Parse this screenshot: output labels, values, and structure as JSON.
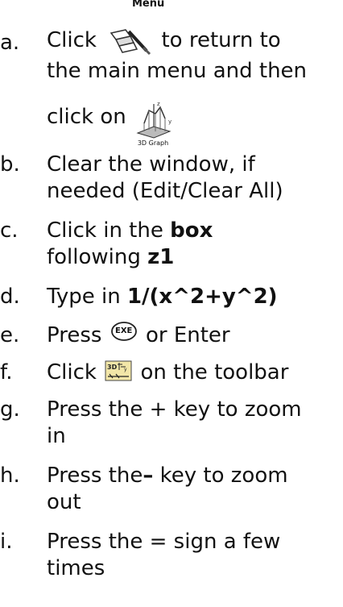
{
  "steps": [
    {
      "letter": "a.",
      "pre": "Click",
      "icon1_caption": "Menu",
      "line1_rest": "to return to",
      "line2": "the main menu and then",
      "line3_pre": "click on",
      "icon2_caption": "3D Graph"
    },
    {
      "letter": "b.",
      "line1": "Clear the window, if",
      "line2": "needed (Edit/Clear All)"
    },
    {
      "letter": "c.",
      "pre": "Click in the",
      "bold1": "box",
      "line2_pre": "following",
      "bold2": "z1"
    },
    {
      "letter": "d.",
      "pre": "Type in",
      "bold": "1/(x^2+y^2)"
    },
    {
      "letter": "e.",
      "pre": "Press",
      "icon_label": "EXE",
      "post": "or Enter"
    },
    {
      "letter": "f.",
      "pre": "Click",
      "post": "on the toolbar"
    },
    {
      "letter": "g.",
      "line1": "Press the + key to zoom",
      "line2": "in"
    },
    {
      "letter": "h.",
      "pre": "Press the",
      "bold": "–",
      "post": "key to zoom",
      "line2": "out"
    },
    {
      "letter": "i.",
      "line1": "Press the = sign a few",
      "line2": "times"
    }
  ],
  "colors": {
    "text": "#111111",
    "icon_stroke": "#333333",
    "toolbar_icon_bg": "#f2e6a8"
  },
  "icons": [
    "menu-book-icon",
    "3d-graph-icon",
    "exe-key-icon",
    "3d-graph-toolbar-icon"
  ]
}
